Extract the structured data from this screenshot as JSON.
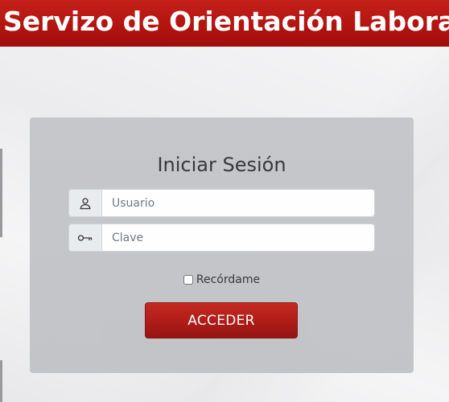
{
  "header": {
    "title": "Servizo de Orientación Laboral"
  },
  "login": {
    "title": "Iniciar Sesión",
    "username": {
      "placeholder": "Usuario",
      "value": "",
      "icon": "user-icon"
    },
    "password": {
      "placeholder": "Clave",
      "value": "",
      "icon": "key-icon"
    },
    "remember_label": "Recórdame",
    "remember_checked": false,
    "submit_label": "ACCEDER"
  },
  "colors": {
    "brand_red": "#b1130f",
    "panel_gray": "#c3c5c9"
  }
}
